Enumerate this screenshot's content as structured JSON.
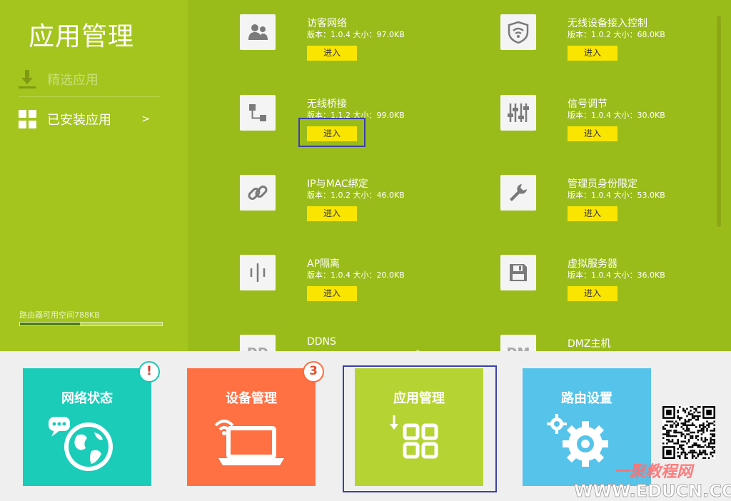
{
  "sidebar": {
    "title": "应用管理",
    "items": [
      {
        "label": "精选应用",
        "icon": "download-icon"
      },
      {
        "label": "已安装应用",
        "icon": "grid-icon",
        "arrow": ">"
      }
    ],
    "storage_label": "路由器可用空间788KB",
    "storage_fraction": 0.42
  },
  "apps": [
    {
      "name": "访客网络",
      "meta": "版本：1.0.4 大小：97.0KB",
      "button": "进入",
      "icon": "guest-users-icon"
    },
    {
      "name": "无线设备接入控制",
      "meta": "版本：1.0.2 大小：68.0KB",
      "button": "进入",
      "icon": "wifi-shield-icon"
    },
    {
      "name": "无线桥接",
      "meta": "版本：1.1.2 大小：99.0KB",
      "button": "进入",
      "icon": "bridge-icon"
    },
    {
      "name": "信号调节",
      "meta": "版本：1.0.4 大小：30.0KB",
      "button": "进入",
      "icon": "signal-sliders-icon"
    },
    {
      "name": "IP与MAC绑定",
      "meta": "版本：1.0.2 大小：46.0KB",
      "button": "进入",
      "icon": "link-icon"
    },
    {
      "name": "管理员身份限定",
      "meta": "版本：1.0.4 大小：53.0KB",
      "button": "进入",
      "icon": "wrench-icon"
    },
    {
      "name": "AP隔离",
      "meta": "版本：1.0.4 大小：20.0KB",
      "button": "进入",
      "icon": "ap-isolation-icon"
    },
    {
      "name": "虚拟服务器",
      "meta": "版本：1.0.4 大小：36.0KB",
      "button": "进入",
      "icon": "server-icon"
    },
    {
      "name": "DDNS",
      "meta": "",
      "button": "",
      "icon": "ddns-icon",
      "icon_text": "DD"
    },
    {
      "name": "DMZ主机",
      "meta": "",
      "button": "",
      "icon": "dmz-icon",
      "icon_text": "DM"
    }
  ],
  "nav": [
    {
      "label": "网络状态",
      "color": "#1bccb9",
      "badge": "!",
      "icon": "globe-chat-icon"
    },
    {
      "label": "设备管理",
      "color": "#ff7043",
      "badge": "3",
      "icon": "laptop-wifi-icon"
    },
    {
      "label": "应用管理",
      "color": "#b5d433",
      "badge": "",
      "icon": "apps-grid-icon"
    },
    {
      "label": "路由设置",
      "color": "#55c3ea",
      "badge": "",
      "icon": "gears-icon"
    }
  ],
  "colors": {
    "sidebar_bg": "#a3c51d",
    "main_bg": "#9abc1a",
    "button_yellow": "#f9e500",
    "highlight_box": "#3b3fad"
  },
  "watermark": {
    "line1": "一聚教程网",
    "line2": "WWW.EDUCN.COM"
  }
}
